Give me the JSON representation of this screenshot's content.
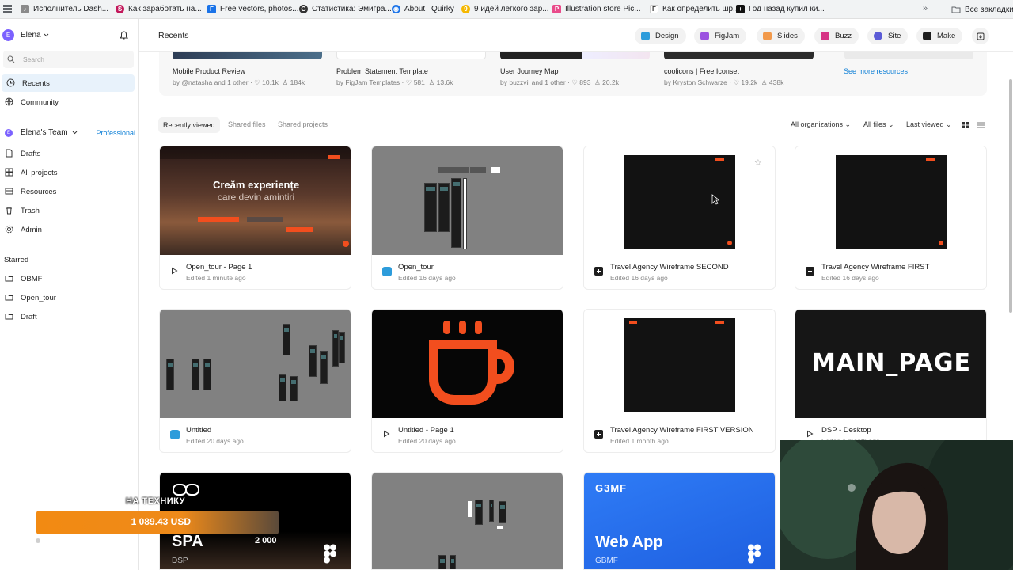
{
  "bookmarks": {
    "items": [
      {
        "label": "Исполнитель Dash...",
        "color": "#7a7a7a",
        "glyph": "♪"
      },
      {
        "label": "Как заработать на...",
        "color": "#c2185b",
        "glyph": "S"
      },
      {
        "label": "Free vectors, photos...",
        "color": "#1a73e8",
        "glyph": "F"
      },
      {
        "label": "Статистика: Эмигра...",
        "color": "#333333",
        "glyph": "G"
      },
      {
        "label": "About",
        "color": "#1a73e8",
        "glyph": "◉"
      },
      {
        "label": "Quirky",
        "color": "#ffffff",
        "glyph": ""
      },
      {
        "label": "9 идей легкого зар...",
        "color": "#f5b800",
        "glyph": "9"
      },
      {
        "label": "Illustration store Pic...",
        "color": "#e94b8a",
        "glyph": "P"
      },
      {
        "label": "Как определить шр...",
        "color": "#ffffff",
        "glyph": "F"
      },
      {
        "label": "Год назад купил ки...",
        "color": "#111111",
        "glyph": "+"
      }
    ],
    "more": "»",
    "all_bookmarks": "Все закладки"
  },
  "account": {
    "initial": "E",
    "name": "Elena"
  },
  "search": {
    "placeholder": "Search"
  },
  "nav": {
    "recents": "Recents",
    "community": "Community"
  },
  "team": {
    "initial": "E",
    "name": "Elena's Team",
    "plan": "Professional"
  },
  "team_nav": [
    "Drafts",
    "All projects",
    "Resources",
    "Trash",
    "Admin"
  ],
  "starred": {
    "heading": "Starred",
    "items": [
      "OBMF",
      "Open_tour",
      "Draft"
    ]
  },
  "header": {
    "title": "Recents",
    "products": [
      {
        "label": "Design",
        "color": "#2d9cdb"
      },
      {
        "label": "FigJam",
        "color": "#9b51e0"
      },
      {
        "label": "Slides",
        "color": "#f2994a"
      },
      {
        "label": "Buzz",
        "color": "#d63384"
      },
      {
        "label": "Site",
        "color": "#5b5bd6"
      },
      {
        "label": "Make",
        "color": "#1e1e1e"
      }
    ]
  },
  "templates": [
    {
      "title": "Mobile Product Review",
      "author": "by @natasha and 1 other",
      "likes": "10.1k",
      "users": "184k"
    },
    {
      "title": "Problem Statement Template",
      "author": "by FigJam Templates",
      "likes": "581",
      "users": "13.6k"
    },
    {
      "title": "User Journey Map",
      "author": "by buzzvil and 1 other",
      "likes": "893",
      "users": "20.2k"
    },
    {
      "title": "coolicons | Free Iconset",
      "author": "by Kryston Schwarze",
      "likes": "19.2k",
      "users": "438k"
    }
  ],
  "see_more": "See more resources",
  "tabs": [
    "Recently viewed",
    "Shared files",
    "Shared projects"
  ],
  "filters": {
    "orgs": "All organizations",
    "files": "All files",
    "sort": "Last viewed"
  },
  "files": [
    {
      "title": "Open_tour - Page 1",
      "edited": "Edited 1 minute ago",
      "icon": "play"
    },
    {
      "title": "Open_tour",
      "edited": "Edited 16 days ago",
      "icon": "design"
    },
    {
      "title": "Travel Agency Wireframe SECOND",
      "edited": "Edited 16 days ago",
      "icon": "site"
    },
    {
      "title": "Travel Agency Wireframe FIRST",
      "edited": "Edited 16 days ago",
      "icon": "site"
    },
    {
      "title": "Untitled",
      "edited": "Edited 20 days ago",
      "icon": "design"
    },
    {
      "title": "Untitled - Page 1",
      "edited": "Edited 20 days ago",
      "icon": "play"
    },
    {
      "title": "Travel Agency Wireframe FIRST VERSION",
      "edited": "Edited 1 month ago",
      "icon": "site"
    },
    {
      "title": "DSP - Desktop",
      "edited": "Edited 1 month ago",
      "icon": "play"
    }
  ],
  "thumbs": {
    "hero_line1": "Creăm experiențe",
    "hero_line2": "care devin amintiri",
    "main_page": "MAIN_PAGE",
    "spa_title": "SPA",
    "spa_count": "2 000",
    "spa_sub": "DSP",
    "gbmf_logo": "G3MF",
    "webapp_title": "Web App",
    "webapp_sub": "GBMF"
  },
  "overlay": {
    "caption": "НА ТЕХНИКУ",
    "amount": "1 089.43 USD"
  },
  "colors": {
    "accent": "#0d99ff",
    "selected_bg": "#e8f2fb",
    "team_purple": "#7b61ff",
    "plan_blue": "#0d7fd6",
    "mug_orange": "#f24e1e",
    "webapp_blue": "#1e6ff1"
  }
}
